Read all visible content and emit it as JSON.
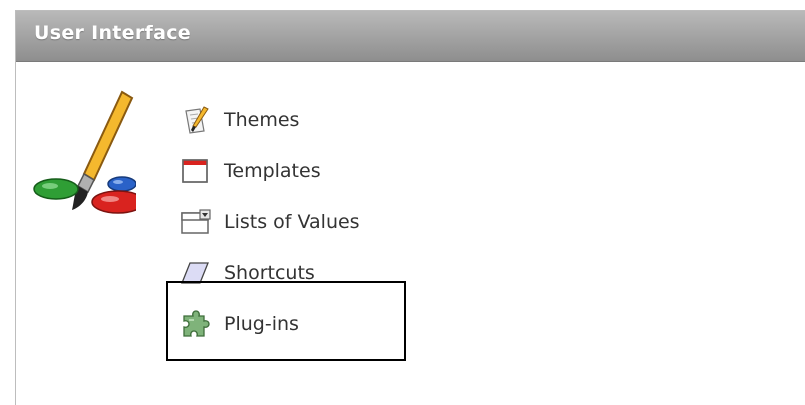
{
  "panel": {
    "title": "User Interface",
    "icon": "paintbrush-palette-icon"
  },
  "menu": {
    "items": [
      {
        "label": "Themes",
        "icon": "themes-icon"
      },
      {
        "label": "Templates",
        "icon": "templates-icon"
      },
      {
        "label": "Lists of Values",
        "icon": "lists-of-values-icon"
      },
      {
        "label": "Shortcuts",
        "icon": "shortcuts-icon"
      },
      {
        "label": "Plug-ins",
        "icon": "puzzle-piece-icon"
      }
    ]
  },
  "colors": {
    "header_top": "#b9b9b9",
    "header_bottom": "#8e8e8e",
    "highlight_border": "#000000"
  }
}
